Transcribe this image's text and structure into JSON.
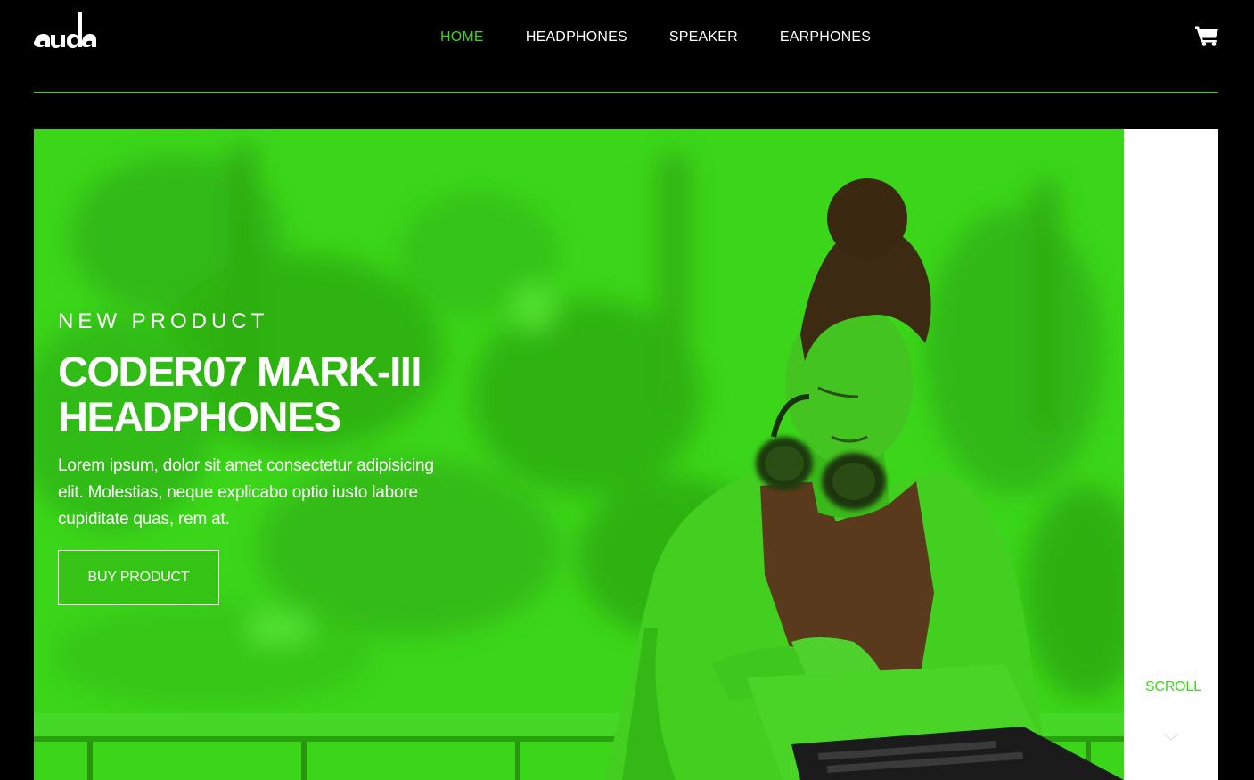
{
  "brand": {
    "logo_text": "auda"
  },
  "nav": {
    "items": [
      {
        "label": "HOME",
        "active": true
      },
      {
        "label": "HEADPHONES",
        "active": false
      },
      {
        "label": "SPEAKER",
        "active": false
      },
      {
        "label": "EARPHONES",
        "active": false
      }
    ],
    "cart_icon": "shopping-cart-icon"
  },
  "colors": {
    "accent": "#3fd61a",
    "hero_tint": "#39d418",
    "background": "#000000"
  },
  "hero": {
    "eyebrow": "NEW PRODUCT",
    "title_line1": "CODER07 MARK-III",
    "title_line2": "HEADPHONES",
    "description": "Lorem ipsum, dolor sit amet consectetur adipisicing elit. Molestias, neque explicabo optio iusto labore cupiditate quas, rem at.",
    "button_label": "BUY PRODUCT"
  },
  "side": {
    "scroll_label": "SCROLL",
    "scroll_icon": "chevron-down-icon"
  }
}
